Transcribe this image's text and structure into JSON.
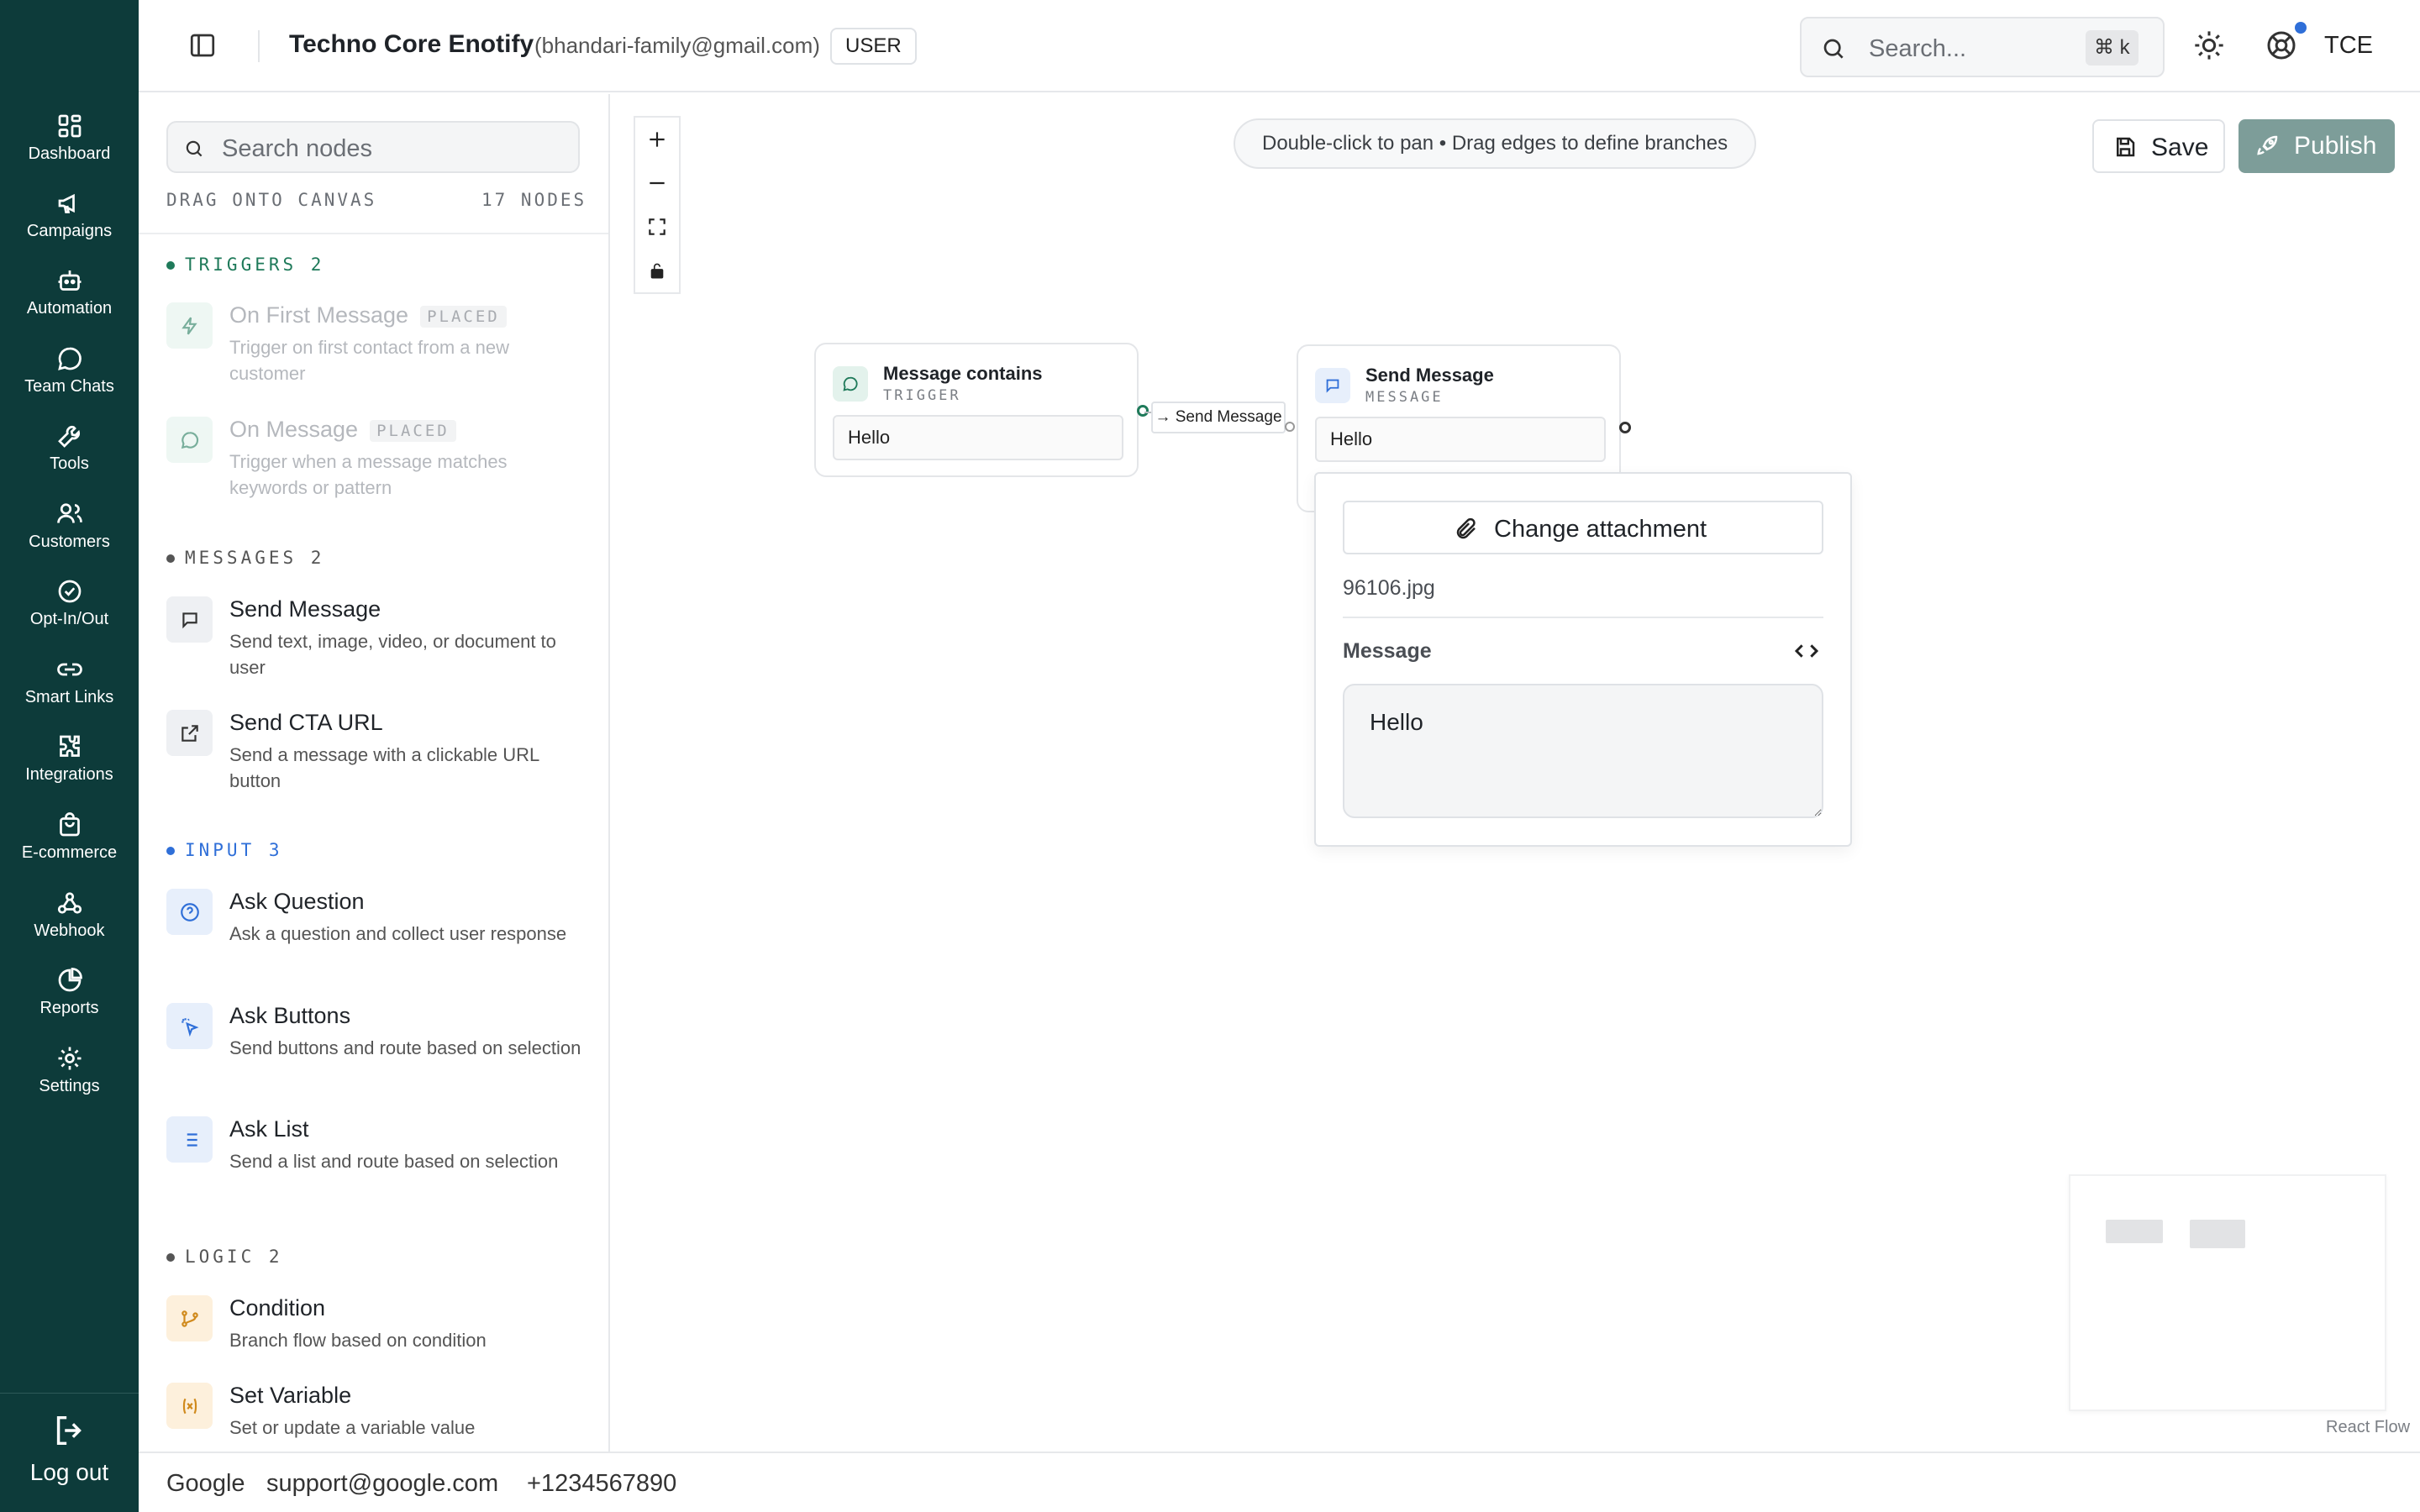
{
  "app": {
    "title": "Techno Core Enotify",
    "email": "(bhandari-family@gmail.com)",
    "role": "USER",
    "avatar": "TCE"
  },
  "search": {
    "placeholder": "Search...",
    "shortcut": "⌘ k"
  },
  "nav": {
    "items": [
      {
        "label": "Dashboard",
        "icon": "dashboard-icon"
      },
      {
        "label": "Campaigns",
        "icon": "megaphone-icon"
      },
      {
        "label": "Automation",
        "icon": "bot-icon"
      },
      {
        "label": "Team Chats",
        "icon": "chat-icon"
      },
      {
        "label": "Tools",
        "icon": "wrench-icon"
      },
      {
        "label": "Customers",
        "icon": "users-icon"
      },
      {
        "label": "Opt-In/Out",
        "icon": "check-circle-icon"
      },
      {
        "label": "Smart Links",
        "icon": "link-icon"
      },
      {
        "label": "Integrations",
        "icon": "puzzle-icon"
      },
      {
        "label": "E-commerce",
        "icon": "shopping-bag-icon"
      },
      {
        "label": "Webhook",
        "icon": "webhook-icon"
      },
      {
        "label": "Reports",
        "icon": "pie-chart-icon"
      },
      {
        "label": "Settings",
        "icon": "gear-icon"
      }
    ],
    "logout": "Log out"
  },
  "palette": {
    "search_placeholder": "Search nodes",
    "drag_hint": "DRAG ONTO CANVAS",
    "node_count": "17 NODES",
    "placed_tag": "PLACED",
    "sections": {
      "triggers": "TRIGGERS 2",
      "messages": "MESSAGES 2",
      "input": "INPUT 3",
      "logic": "LOGIC 2"
    },
    "items": [
      {
        "title": "On First Message",
        "desc": "Trigger on first contact from a new customer"
      },
      {
        "title": "On Message",
        "desc": "Trigger when a message matches keywords or pattern"
      },
      {
        "title": "Send Message",
        "desc": "Send text, image, video, or document to user"
      },
      {
        "title": "Send CTA URL",
        "desc": "Send a message with a clickable URL button"
      },
      {
        "title": "Ask Question",
        "desc": "Ask a question and collect user response"
      },
      {
        "title": "Ask Buttons",
        "desc": "Send buttons and route based on selection"
      },
      {
        "title": "Ask List",
        "desc": "Send a list and route based on selection"
      },
      {
        "title": "Condition",
        "desc": "Branch flow based on condition"
      },
      {
        "title": "Set Variable",
        "desc": "Set or update a variable value"
      }
    ]
  },
  "canvas": {
    "hint": "Double-click to pan • Drag edges to define branches",
    "save_label": "Save",
    "publish_label": "Publish",
    "nodes": {
      "trigger": {
        "title": "Message contains",
        "type": "TRIGGER",
        "text": "Hello"
      },
      "message": {
        "title": "Send Message",
        "type": "MESSAGE",
        "text": "Hello"
      }
    },
    "edge_label": "→ Send Message",
    "popover": {
      "attach_label": "Change attachment",
      "filename": "96106.jpg",
      "message_label": "Message",
      "message_value": "Hello"
    },
    "attribution": "React Flow"
  },
  "footer": {
    "company": "Google",
    "email": "support@google.com",
    "phone": "+1234567890"
  },
  "colors": {
    "rail": "#0d3b3a",
    "publish": "#7d9d99",
    "trigger_accent": "#1f7a5a",
    "input_accent": "#2f6fd8",
    "logic_accent": "#d08a1c"
  }
}
